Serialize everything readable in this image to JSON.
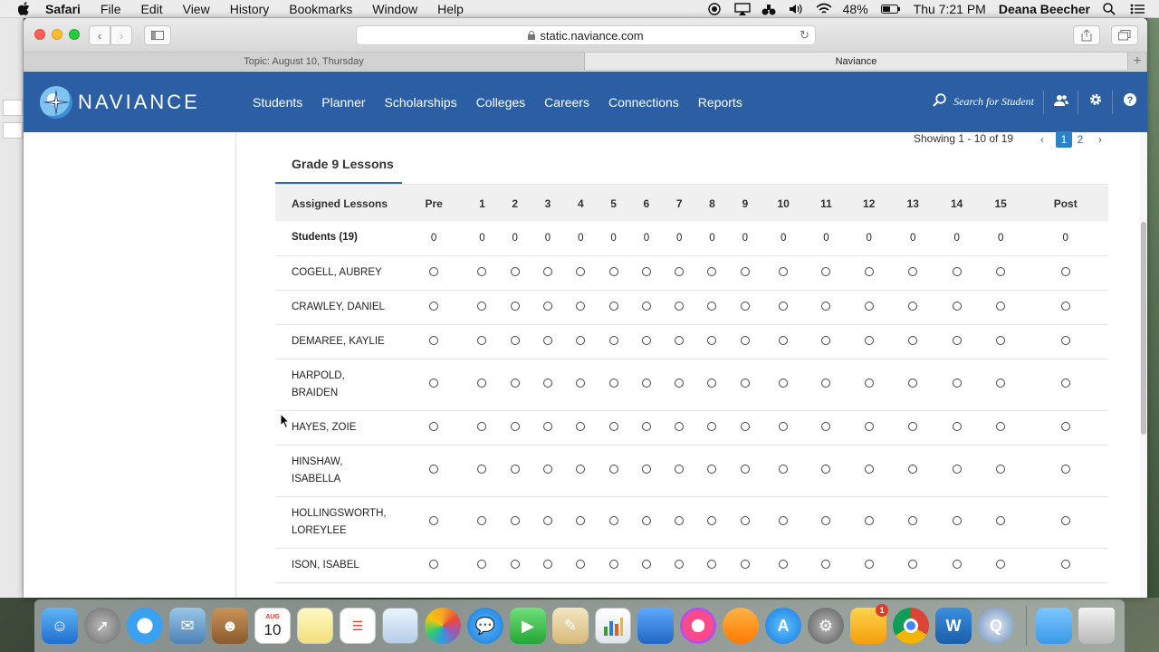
{
  "menubar": {
    "app": "Safari",
    "items": [
      "File",
      "Edit",
      "View",
      "History",
      "Bookmarks",
      "Window",
      "Help"
    ],
    "battery": "48%",
    "clock": "Thu 7:21 PM",
    "user": "Deana Beecher"
  },
  "browser": {
    "url": "static.naviance.com",
    "tabs": [
      "Topic: August 10, Thursday",
      "Naviance"
    ]
  },
  "naviance": {
    "logo": "NAVIANCE",
    "nav": [
      "Students",
      "Planner",
      "Scholarships",
      "Colleges",
      "Careers",
      "Connections",
      "Reports"
    ],
    "search_placeholder": "Search for Student"
  },
  "pager": {
    "showing": "Showing 1 - 10 of 19",
    "pages": [
      "1",
      "2"
    ],
    "current": "1"
  },
  "section_title": "Grade 9 Lessons",
  "table": {
    "header_label": "Assigned Lessons",
    "columns": [
      "Pre",
      "1",
      "2",
      "3",
      "4",
      "5",
      "6",
      "7",
      "8",
      "9",
      "10",
      "11",
      "12",
      "13",
      "14",
      "15",
      "Post"
    ],
    "summary_label": "Students (19)",
    "summary_values": [
      "0",
      "0",
      "0",
      "0",
      "0",
      "0",
      "0",
      "0",
      "0",
      "0",
      "0",
      "0",
      "0",
      "0",
      "0",
      "0",
      "0"
    ],
    "students": [
      {
        "name": "COGELL, AUBREY",
        "tall": false
      },
      {
        "name": "CRAWLEY, DANIEL",
        "tall": false
      },
      {
        "name": "DEMAREE, KAYLIE",
        "tall": false
      },
      {
        "name": "HARPOLD, BRAIDEN",
        "tall": true
      },
      {
        "name": "HAYES, ZOIE",
        "tall": false
      },
      {
        "name": "HINSHAW, ISABELLA",
        "tall": true
      },
      {
        "name": "HOLLINGSWORTH, LOREYLEE",
        "tall": true
      },
      {
        "name": "ISON, ISABEL",
        "tall": false
      }
    ]
  },
  "dock": {
    "calendar_month": "AUG",
    "calendar_day": "10",
    "mail_badge": "1"
  }
}
